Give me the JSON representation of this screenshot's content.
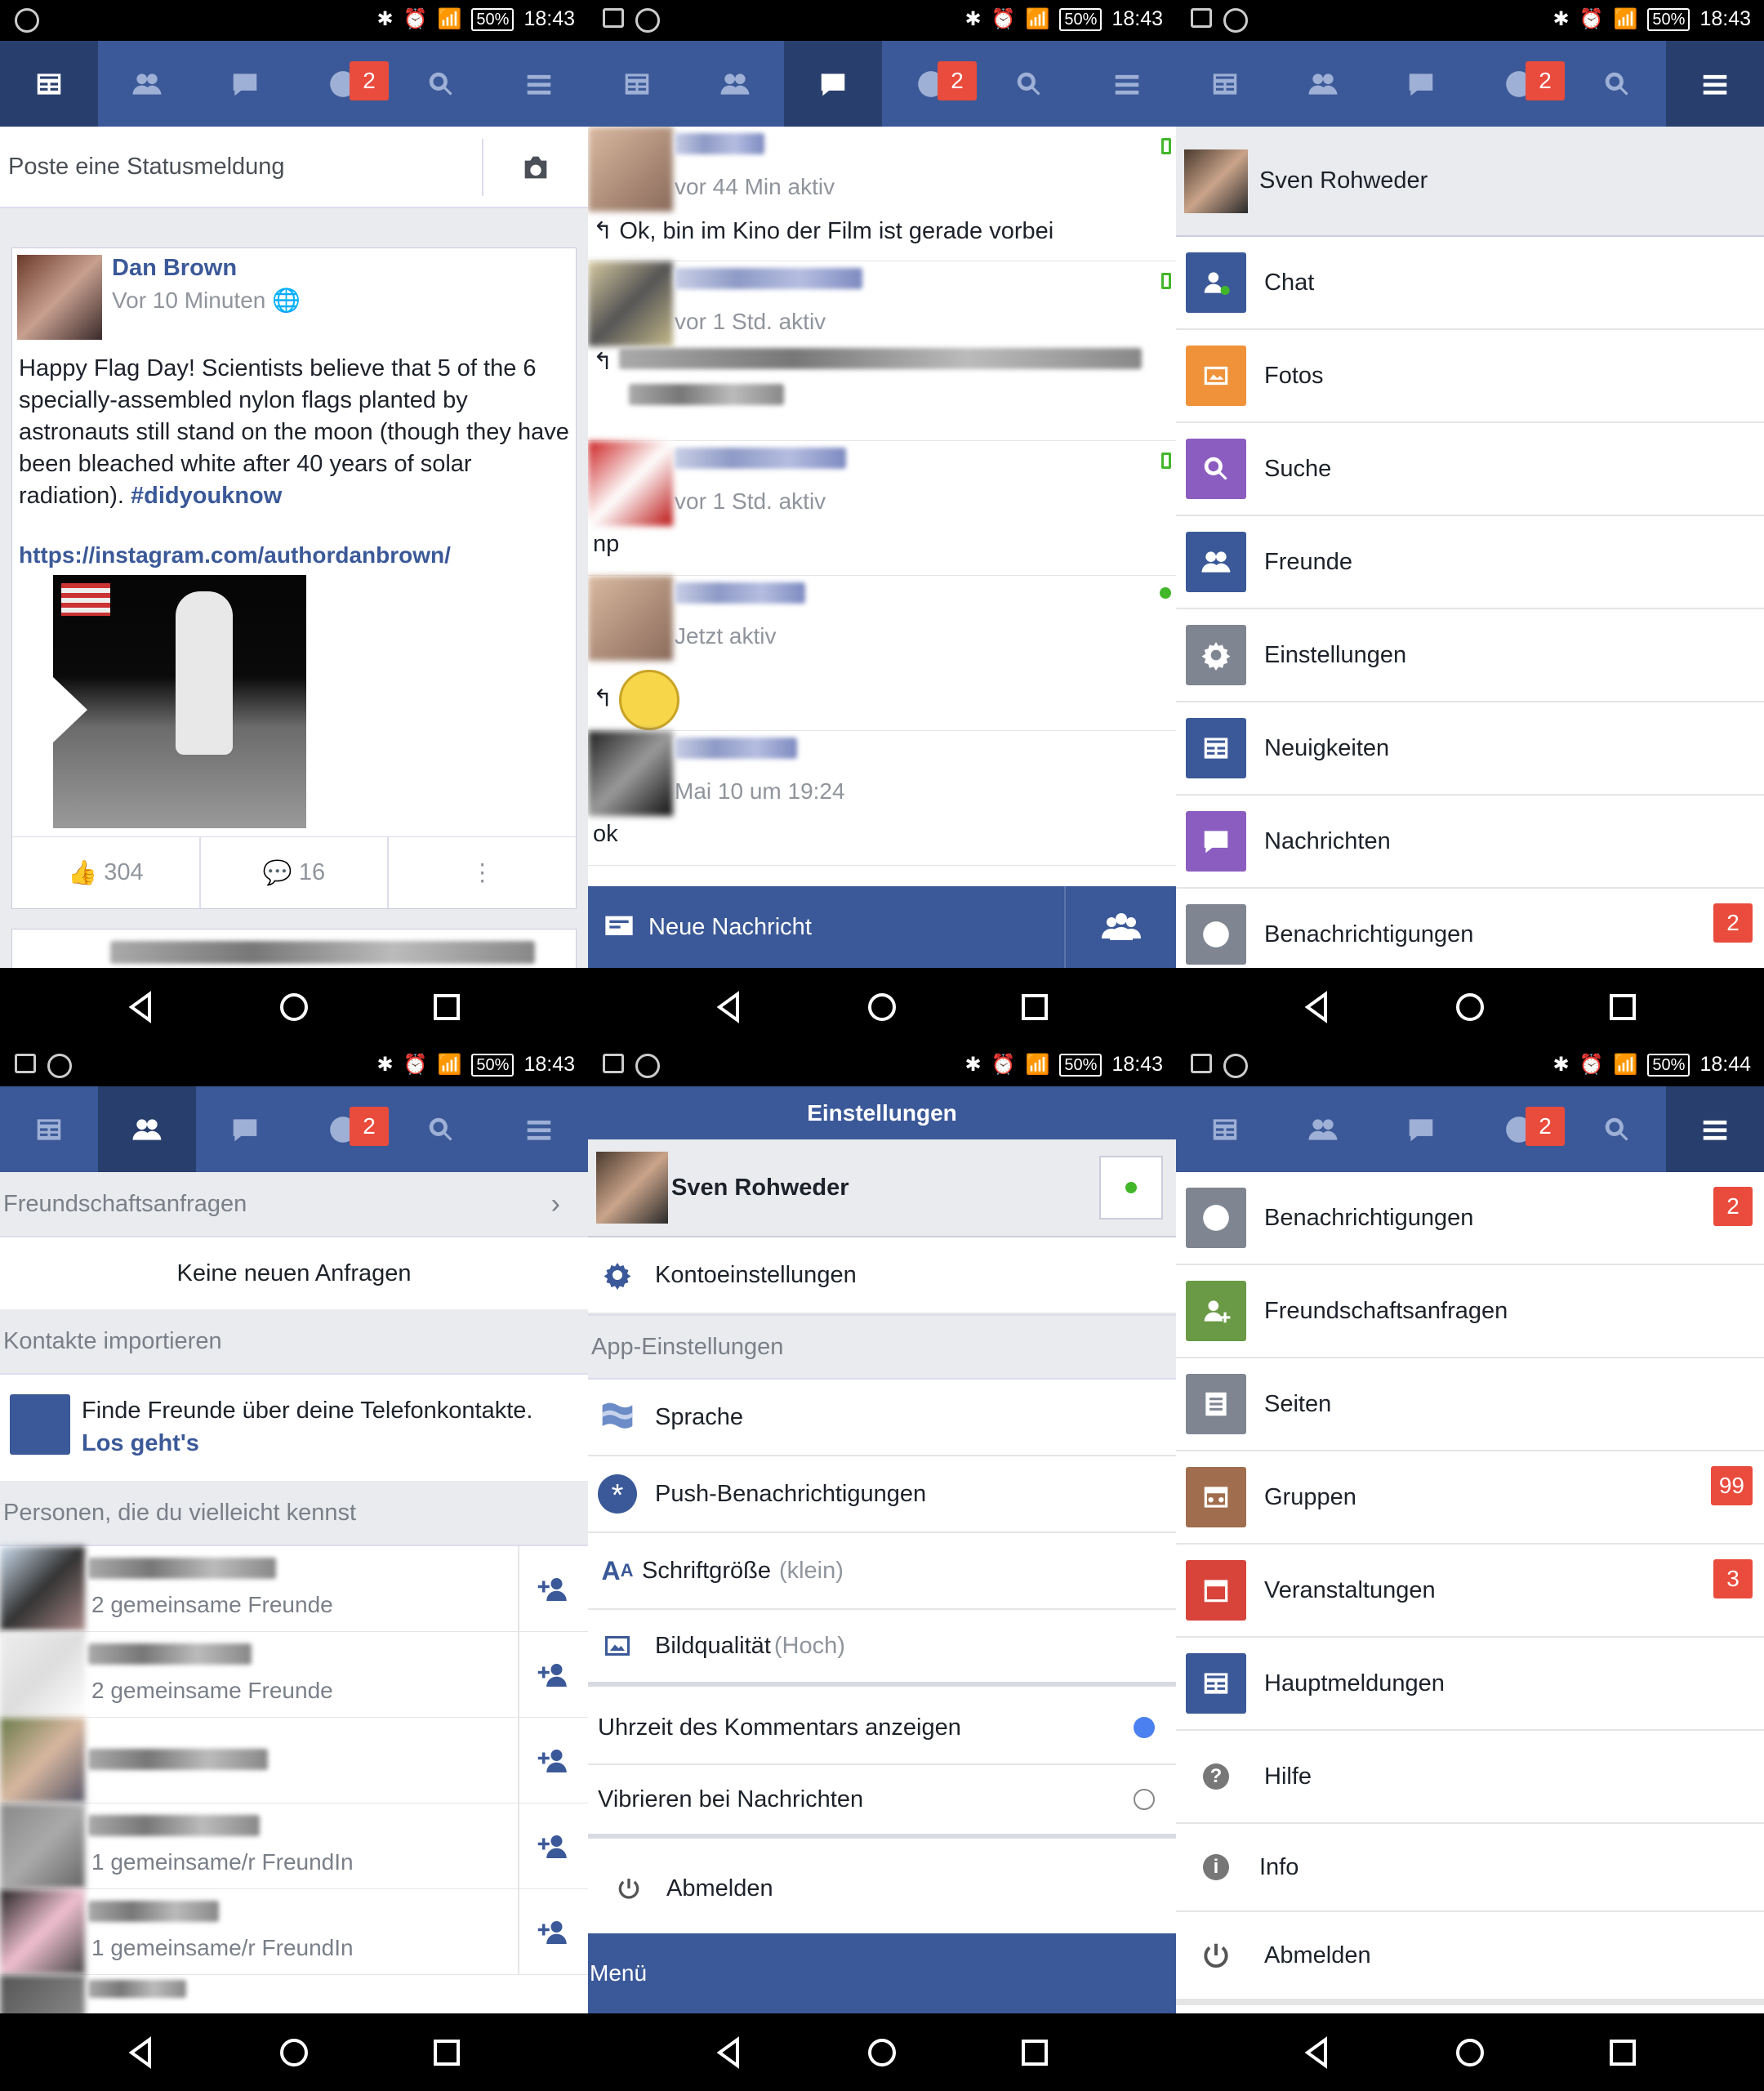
{
  "status": {
    "time_default": "18:43",
    "time_last": "18:44",
    "battery": "50%"
  },
  "nav": {
    "badge": "2"
  },
  "feed": {
    "compose_placeholder": "Poste eine Statusmeldung",
    "post": {
      "author": "Dan Brown",
      "time": "Vor 10 Minuten",
      "text": "Happy Flag Day! Scientists believe that 5 of the 6 specially-assembled nylon  flags planted by astronauts still stand on the moon (though they have been bleached white after 40 years of solar radiation). ",
      "hashtag": "#didyouknow",
      "link": "https://instagram.com/authordanbrown/",
      "likes": "304",
      "comments": "16"
    }
  },
  "chat": {
    "items": [
      {
        "time": "vor 44 Min aktiv",
        "message": "Ok, bin im Kino der Film ist gerade vorbei"
      },
      {
        "time": "vor 1 Std. aktiv",
        "message": ""
      },
      {
        "time": "vor 1 Std. aktiv",
        "message": "np"
      },
      {
        "time": "Jetzt aktiv",
        "message": ""
      },
      {
        "time": "Mai 10 um 19:24",
        "message": "ok"
      }
    ],
    "new_message": "Neue Nachricht"
  },
  "menu1": {
    "user": "Sven Rohweder",
    "items": [
      {
        "label": "Chat",
        "icon": "chat-icon",
        "color": "#3b5998"
      },
      {
        "label": "Fotos",
        "icon": "photos-icon",
        "color": "#f0923a"
      },
      {
        "label": "Suche",
        "icon": "search-icon",
        "color": "#8c5dc1"
      },
      {
        "label": "Freunde",
        "icon": "friends-icon",
        "color": "#3b5998"
      },
      {
        "label": "Einstellungen",
        "icon": "gear-icon",
        "color": "#7f8591"
      },
      {
        "label": "Neuigkeiten",
        "icon": "news-icon",
        "color": "#3b5998"
      },
      {
        "label": "Nachrichten",
        "icon": "messages-icon",
        "color": "#8c5dc1"
      },
      {
        "label": "Benachrichtigungen",
        "icon": "globe-icon",
        "color": "#7f8591",
        "badge": "2"
      }
    ]
  },
  "friends": {
    "requests_header": "Freundschaftsanfragen",
    "no_requests": "Keine neuen Anfragen",
    "import_header": "Kontakte importieren",
    "import_text": "Finde Freunde über deine Telefonkontakte. ",
    "import_link": "Los geht's",
    "pymk_header": "Personen, die du vielleicht kennst",
    "people": [
      {
        "mutual": "2 gemeinsame Freunde"
      },
      {
        "mutual": "2 gemeinsame Freunde"
      },
      {
        "mutual": ""
      },
      {
        "mutual": "1 gemeinsame/r FreundIn"
      },
      {
        "mutual": "1 gemeinsame/r FreundIn"
      }
    ]
  },
  "settings": {
    "title": "Einstellungen",
    "user": "Sven Rohweder",
    "account": "Kontoeinstellungen",
    "app_header": "App-Einstellungen",
    "language": "Sprache",
    "push": "Push-Benachrichtigungen",
    "font_size": "Schriftgröße",
    "font_size_value": "(klein)",
    "image_quality": "Bildqualität",
    "image_quality_value": "(Hoch)",
    "show_time": "Uhrzeit des Kommentars anzeigen",
    "vibrate": "Vibrieren bei Nachrichten",
    "logout": "Abmelden",
    "menu_footer": "Menü"
  },
  "menu2": {
    "items": [
      {
        "label": "Benachrichtigungen",
        "icon": "globe-icon",
        "color": "#7f8591",
        "badge": "2"
      },
      {
        "label": "Freundschaftsanfragen",
        "icon": "add-friend-icon",
        "color": "#6a9a45"
      },
      {
        "label": "Seiten",
        "icon": "pages-icon",
        "color": "#7f8591"
      },
      {
        "label": "Gruppen",
        "icon": "groups-icon",
        "color": "#a06e4e",
        "badge": "99"
      },
      {
        "label": "Veranstaltungen",
        "icon": "calendar-icon",
        "color": "#d8443a",
        "badge": "3"
      },
      {
        "label": "Hauptmeldungen",
        "icon": "news-icon",
        "color": "#3b5998"
      },
      {
        "label": "Hilfe",
        "icon": "help-icon",
        "color": ""
      },
      {
        "label": "Info",
        "icon": "info-icon",
        "color": ""
      },
      {
        "label": "Abmelden",
        "icon": "power-icon",
        "color": ""
      }
    ]
  }
}
